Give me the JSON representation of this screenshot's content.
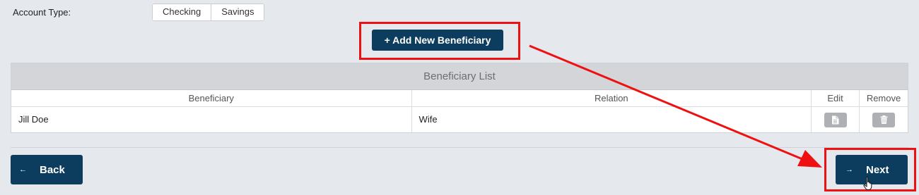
{
  "form": {
    "account_type_label": "Account Type:",
    "account_type_options": [
      "Checking",
      "Savings"
    ]
  },
  "add_button_label": "+ Add New Beneficiary",
  "table": {
    "title": "Beneficiary List",
    "columns": [
      "Beneficiary",
      "Relation",
      "Edit",
      "Remove"
    ],
    "rows": [
      {
        "beneficiary": "Jill Doe",
        "relation": "Wife"
      }
    ]
  },
  "nav": {
    "back_label": "Back",
    "next_label": "Next",
    "back_icon": "arrow-left-icon",
    "next_icon": "arrow-right-icon"
  },
  "annotations": {
    "highlight_color": "#ee1111",
    "arrow_color": "#ee1111"
  },
  "colors": {
    "primary": "#0d3d5e",
    "background": "#e5e8ed",
    "table_header": "#d3d5d8",
    "icon_button": "#aeb0b3"
  }
}
